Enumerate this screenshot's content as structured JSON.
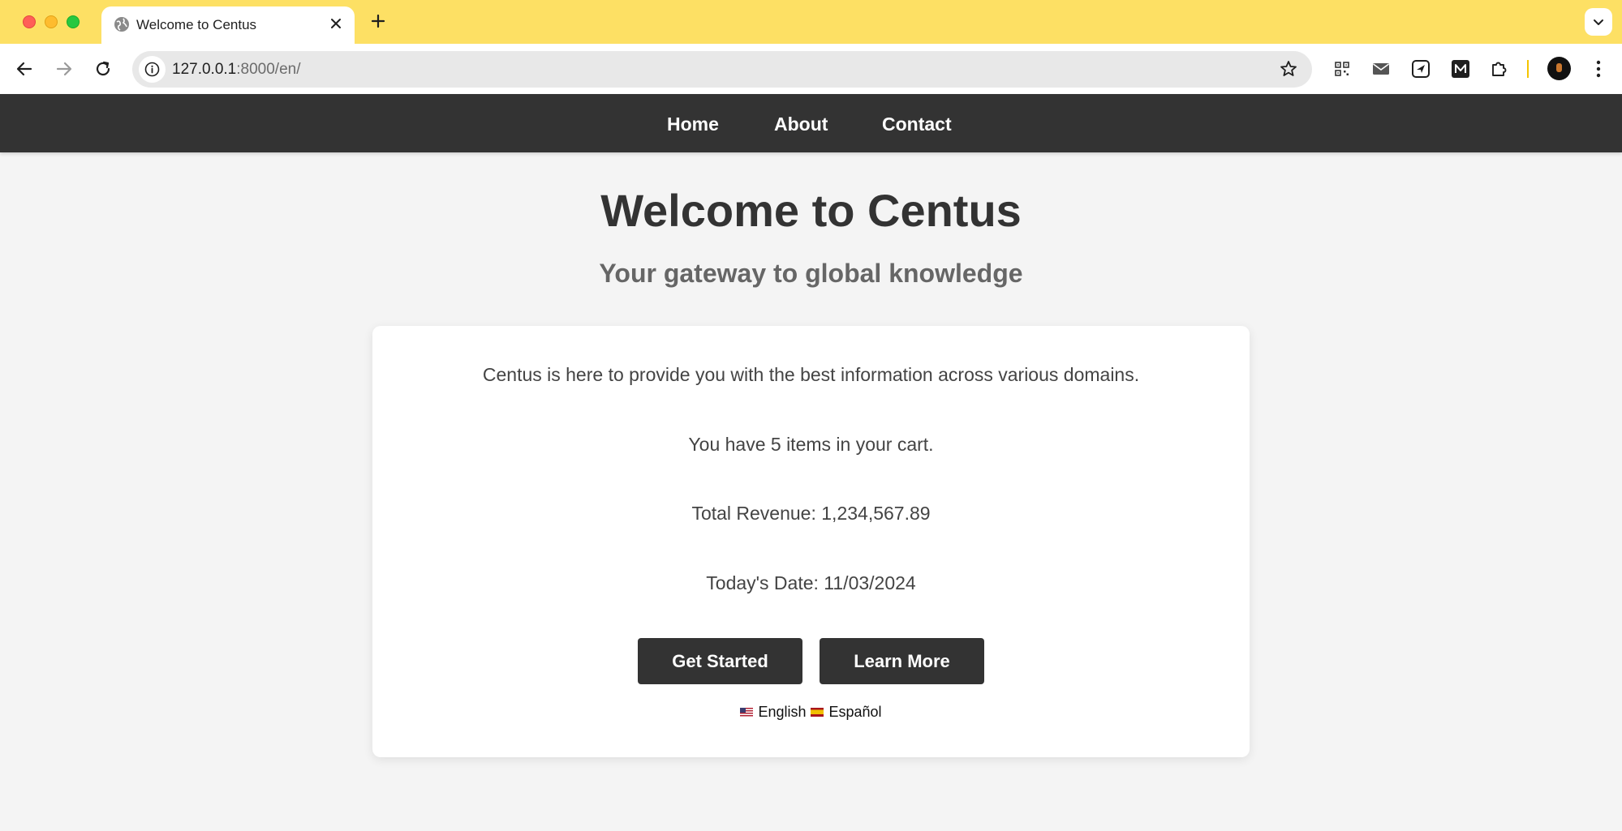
{
  "browser": {
    "tab_title": "Welcome to Centus",
    "url_host": "127.0.0.1",
    "url_rest": ":8000/en/"
  },
  "nav": {
    "links": [
      "Home",
      "About",
      "Contact"
    ]
  },
  "hero": {
    "title": "Welcome to Centus",
    "subtitle": "Your gateway to global knowledge"
  },
  "card": {
    "intro": "Centus is here to provide you with the best information across various domains.",
    "cart": "You have 5 items in your cart.",
    "revenue": "Total Revenue: 1,234,567.89",
    "date": "Today's Date: 11/03/2024",
    "buttons": {
      "get_started": "Get Started",
      "learn_more": "Learn More"
    },
    "languages": [
      {
        "flag": "us-flag",
        "label": "English"
      },
      {
        "flag": "es-flag",
        "label": "Español"
      }
    ]
  },
  "colors": {
    "tabbar": "#fde064",
    "site_nav": "#333333",
    "button": "#333333",
    "page_bg": "#f4f4f4"
  }
}
